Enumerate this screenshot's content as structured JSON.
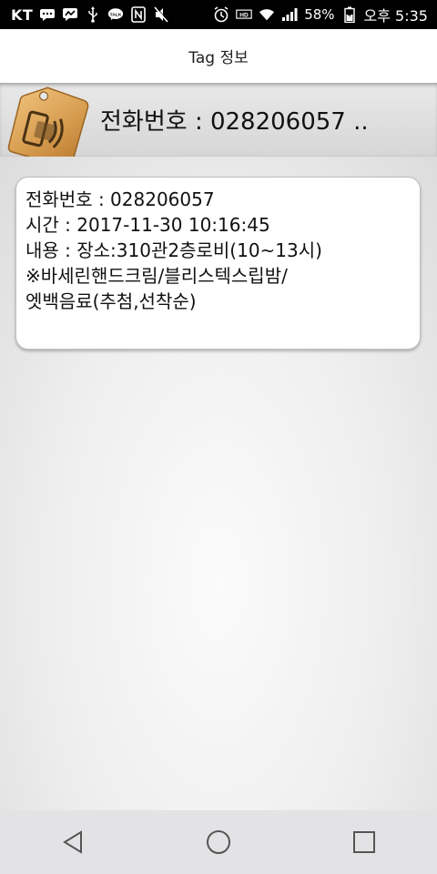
{
  "status_bar": {
    "carrier": "KT",
    "battery_percent": "58%",
    "time": "오후 5:35",
    "icons": [
      "chat-icon",
      "messenger-icon",
      "usb-icon",
      "kakaotalk-icon",
      "nfc-icon",
      "mute-icon",
      "alarm-icon",
      "hd-voice-icon",
      "wifi-icon",
      "signal-icon",
      "battery-icon"
    ]
  },
  "titlebar": {
    "title": "Tag 정보"
  },
  "banner": {
    "title": "전화번호 : 028206057 .."
  },
  "card": {
    "lines": [
      "전화번호 : 028206057",
      "시간 : 2017-11-30 10:16:45",
      "내용 : 장소:310관2층로비(10~13시)",
      "※바세린핸드크림/블리스텍스립밤/",
      "엣백음료(추첨,선착순)"
    ]
  },
  "nav": {
    "buttons": [
      "back-icon",
      "home-icon",
      "recents-icon"
    ]
  },
  "colors": {
    "tag": "#d9a35a",
    "card_border": "#bdbdbd",
    "nav_bg": "#e3e3e6"
  }
}
